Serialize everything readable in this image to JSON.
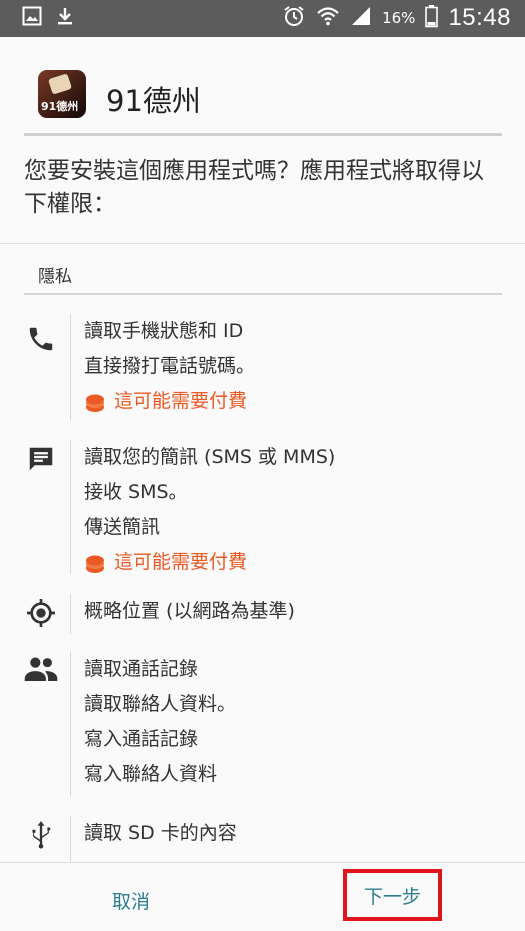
{
  "status_bar": {
    "battery_percent": "16%",
    "time": "15:48"
  },
  "app": {
    "icon_text": "91德州",
    "name": "91德州"
  },
  "prompt": "您要安裝這個應用程式嗎？應用程式將取得以下權限：",
  "section_title": "隱私",
  "permissions": [
    {
      "icon": "phone-icon",
      "lines": [
        "讀取手機狀態和 ID",
        "直接撥打電話號碼。"
      ],
      "warning": "這可能需要付費"
    },
    {
      "icon": "message-icon",
      "lines": [
        "讀取您的簡訊 (SMS 或 MMS)",
        "接收 SMS。",
        "傳送簡訊"
      ],
      "warning": "這可能需要付費"
    },
    {
      "icon": "location-icon",
      "lines": [
        "概略位置 (以網路為基準)"
      ]
    },
    {
      "icon": "people-icon",
      "lines": [
        "讀取通話記錄",
        "讀取聯絡人資料。",
        "寫入通話記錄",
        "寫入聯絡人資料"
      ]
    },
    {
      "icon": "usb-icon",
      "lines": [
        "讀取 SD 卡的內容"
      ]
    }
  ],
  "buttons": {
    "cancel": "取消",
    "next": "下一步"
  },
  "colors": {
    "warning": "#ec5a24",
    "button_text": "#2e7d8f",
    "highlight_box": "#e0141c",
    "status_bar": "#5c5c5c"
  }
}
